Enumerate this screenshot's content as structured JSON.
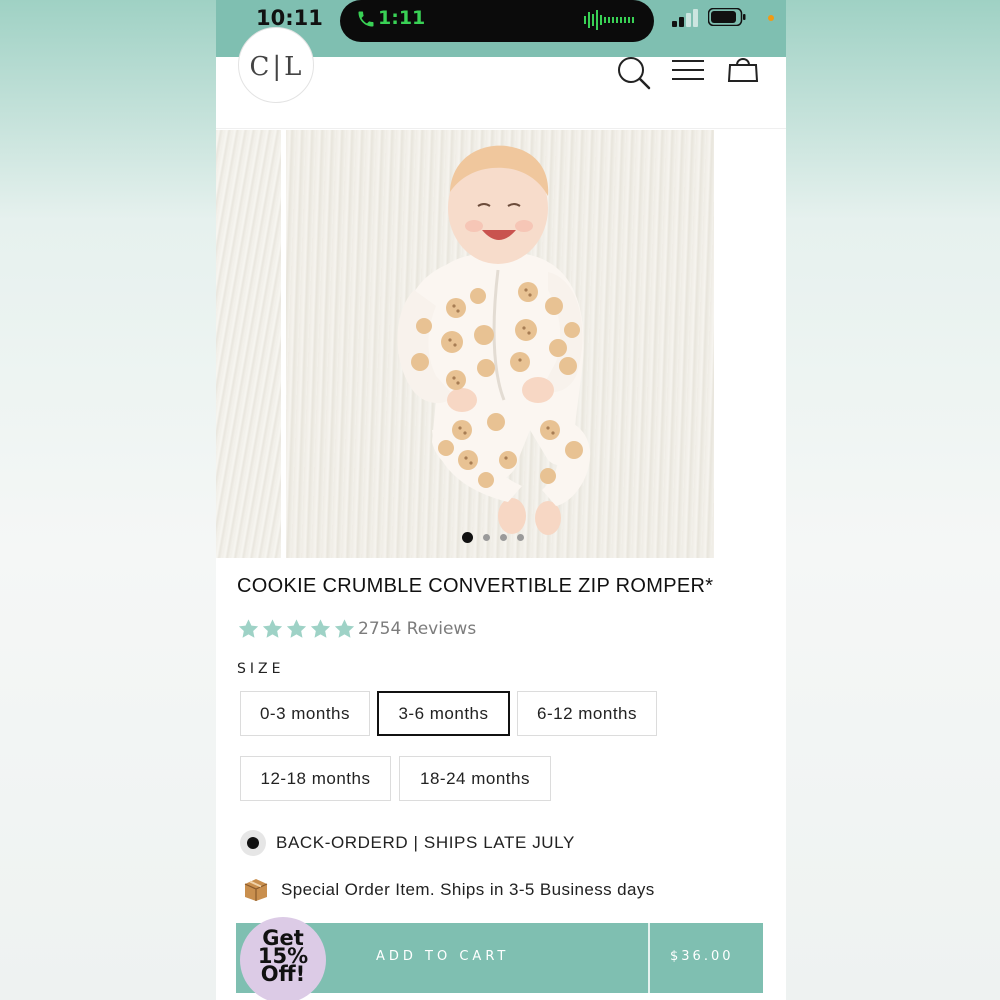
{
  "status_bar": {
    "time": "10:11",
    "call_time": "1:11",
    "call_color": "#39d155",
    "icons": [
      "phone-icon",
      "waveform-icon",
      "signal-icon",
      "battery-icon"
    ]
  },
  "header": {
    "logo_text": "C|L",
    "icons": [
      "search-icon",
      "menu-icon",
      "cart-icon"
    ]
  },
  "gallery": {
    "image_count": 4,
    "active_index": 0
  },
  "product": {
    "title": "COOKIE CRUMBLE CONVERTIBLE ZIP ROMPER*",
    "rating_stars": 5,
    "reviews": "2754 Reviews",
    "star_color": "#9ed2c6"
  },
  "size": {
    "label": "SIZE",
    "options": [
      "0-3 months",
      "3-6 months",
      "6-12 months",
      "12-18 months",
      "18-24 months"
    ],
    "selected": "3-6 months"
  },
  "availability": {
    "stock_text": "BACK-ORDERD | SHIPS LATE JULY",
    "special_text": "Special Order Item. Ships in 3-5 Business days",
    "special_icon": "package-icon"
  },
  "cart": {
    "button_label": "ADD TO CART",
    "price": "$36.00",
    "accent": "#7fbfb1"
  },
  "promo": {
    "line1": "Get",
    "line2": "15%",
    "line3": "Off!"
  }
}
